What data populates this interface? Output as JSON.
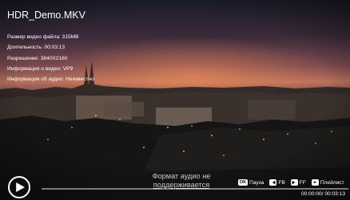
{
  "file": {
    "title": "HDR_Demo.MKV"
  },
  "info": [
    "Размер видео файла: 315MB",
    "Длительность: 00:03:13",
    "Разрешение: 3840X2160",
    "Информация о видео: VP9",
    "Информация об аудио: Неизвестно"
  ],
  "message": {
    "line1": "Формат аудио не",
    "line2": "поддерживается"
  },
  "controls": {
    "ok_key": "OK",
    "pause_label": "Пауза",
    "fb_label": "FB",
    "ff_label": "FF",
    "playlist_label": "Плейлист"
  },
  "playback": {
    "time": "00:00:00/ 00:03:13",
    "progress": 0
  },
  "icons": {
    "play": "play-icon",
    "rewind": "rewind-icon",
    "forward": "fast-forward-icon",
    "playlist": "playlist-icon"
  }
}
